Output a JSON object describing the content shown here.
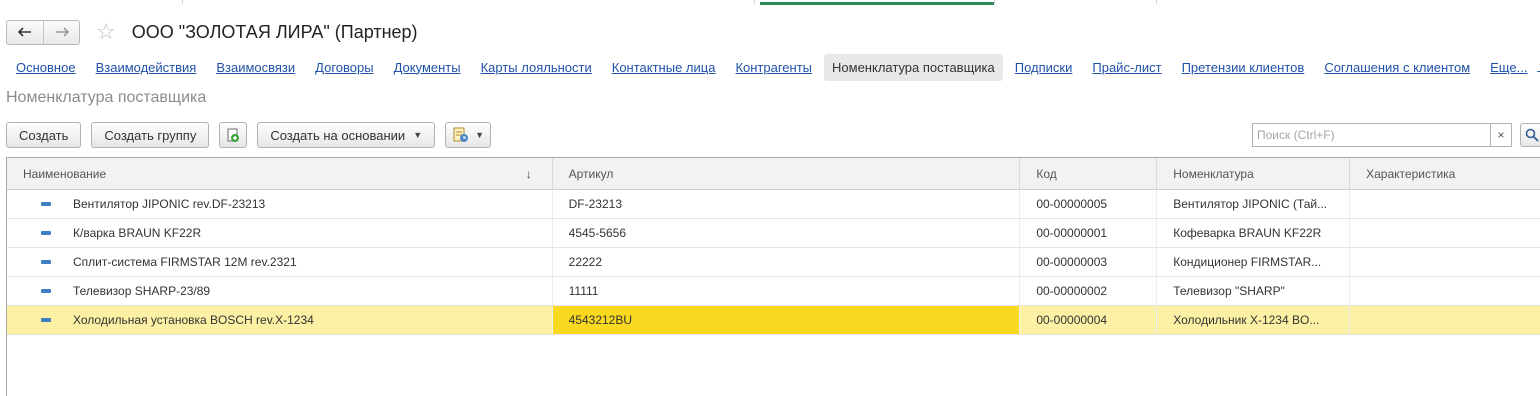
{
  "header": {
    "title": "ООО \"ЗОЛОТАЯ ЛИРА\" (Партнер)",
    "back_icon": "arrow-left-icon",
    "forward_icon": "arrow-right-icon",
    "favorite_icon": "star-icon"
  },
  "tabs": [
    {
      "label": "Основное",
      "active": false
    },
    {
      "label": "Взаимодействия",
      "active": false
    },
    {
      "label": "Взаимосвязи",
      "active": false
    },
    {
      "label": "Договоры",
      "active": false
    },
    {
      "label": "Документы",
      "active": false
    },
    {
      "label": "Карты лояльности",
      "active": false
    },
    {
      "label": "Контактные лица",
      "active": false
    },
    {
      "label": "Контрагенты",
      "active": false
    },
    {
      "label": "Номенклатура поставщика",
      "active": true
    },
    {
      "label": "Подписки",
      "active": false
    },
    {
      "label": "Прайс-лист",
      "active": false
    },
    {
      "label": "Претензии клиентов",
      "active": false
    },
    {
      "label": "Соглашения с клиентом",
      "active": false
    }
  ],
  "tabs_more": "Еще...",
  "section_title": "Номенклатура поставщика",
  "toolbar": {
    "create": "Создать",
    "create_group": "Создать группу",
    "create_based_on": "Создать на основании"
  },
  "search": {
    "placeholder": "Поиск (Ctrl+F)",
    "clear": "×"
  },
  "table": {
    "columns": [
      "Наименование",
      "Артикул",
      "Код",
      "Номенклатура",
      "Характеристика"
    ],
    "rows": [
      {
        "name": "Вентилятор JIPONIC rev.DF-23213",
        "article": "DF-23213",
        "code": "00-00000005",
        "nomenclature": "Вентилятор JIPONIC (Тай...",
        "characteristic": ""
      },
      {
        "name": "К/варка BRAUN KF22R",
        "article": "4545-5656",
        "code": "00-00000001",
        "nomenclature": "Кофеварка BRAUN KF22R",
        "characteristic": ""
      },
      {
        "name": "Сплит-система FIRMSTAR 12M rev.2321",
        "article": "22222",
        "code": "00-00000003",
        "nomenclature": "Кондиционер FIRMSTAR...",
        "characteristic": ""
      },
      {
        "name": "Телевизор SHARP-23/89",
        "article": "11111",
        "code": "00-00000002",
        "nomenclature": "Телевизор \"SHARP\"",
        "characteristic": ""
      },
      {
        "name": "Холодильная установка BOSCH rev.X-1234",
        "article": "4543212BU",
        "code": "00-00000004",
        "nomenclature": "Холодильник X-1234 BO...",
        "characteristic": ""
      }
    ]
  },
  "colors": {
    "link": "#2152a8",
    "selected_row": "#fbf0a4",
    "current_cell": "#f8d91f",
    "active_tab_strip": "#2e8b57"
  }
}
